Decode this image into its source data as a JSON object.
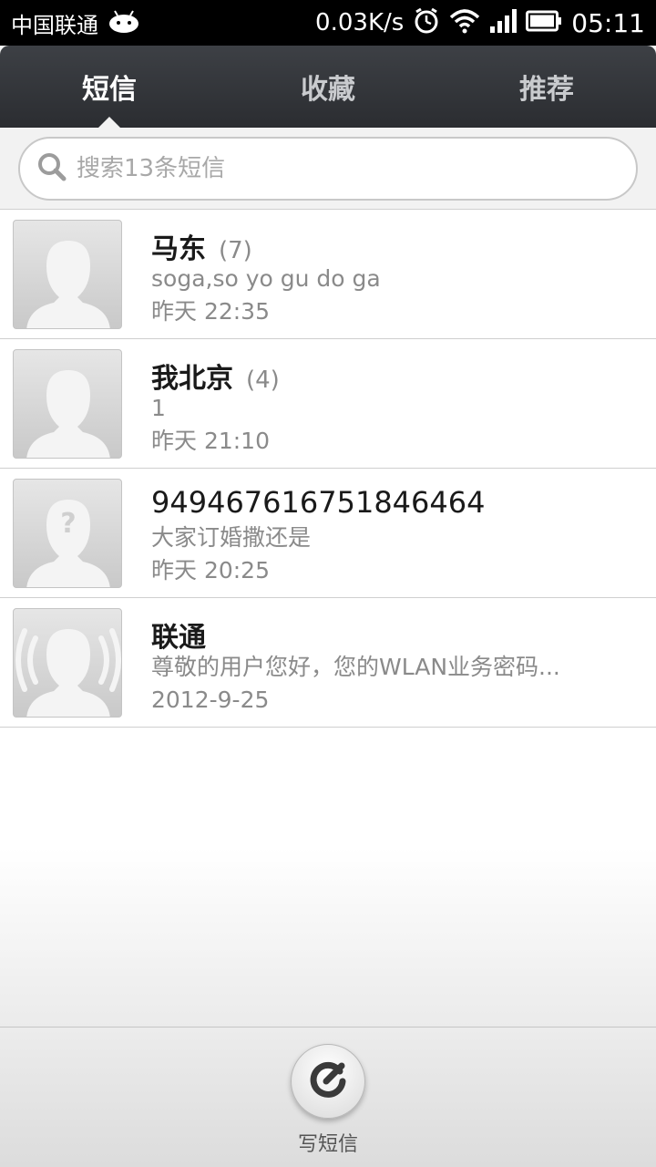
{
  "status_bar": {
    "carrier": "中国联通",
    "net_speed": "0.03K/s",
    "time": "05:11",
    "icons": [
      "android-icon",
      "alarm-icon",
      "wifi-icon",
      "signal-icon",
      "battery-icon"
    ]
  },
  "tabs": [
    {
      "label": "短信",
      "active": true
    },
    {
      "label": "收藏",
      "active": false
    },
    {
      "label": "推荐",
      "active": false
    }
  ],
  "search": {
    "placeholder": "搜索13条短信"
  },
  "conversations": [
    {
      "name": "马东",
      "count": "(7)",
      "preview": "soga,so yo gu do ga",
      "time": "昨天 22:35",
      "avatar": "contact-avatar-icon"
    },
    {
      "name": "我北京",
      "count": "(4)",
      "preview": "1",
      "time": "昨天 21:10",
      "avatar": "contact-avatar-icon"
    },
    {
      "name": "94946761675184646​4",
      "count": "",
      "preview": "大家订婚撒还是",
      "time": "昨天 20:25",
      "avatar": "unknown-contact-avatar-icon"
    },
    {
      "name": "联通",
      "count": "",
      "preview": "尊敬的用户您好，您的WLAN业务密码...",
      "time": "2012-9-25",
      "avatar": "service-contact-avatar-icon"
    }
  ],
  "bottom_bar": {
    "compose_label": "写短信",
    "compose_icon": "compose-icon"
  },
  "colors": {
    "tab_bar_bg": "#2f3136",
    "active_tab_text": "#ffffff",
    "inactive_tab_text": "#c9cbce",
    "secondary_text": "#8a8a8a"
  }
}
